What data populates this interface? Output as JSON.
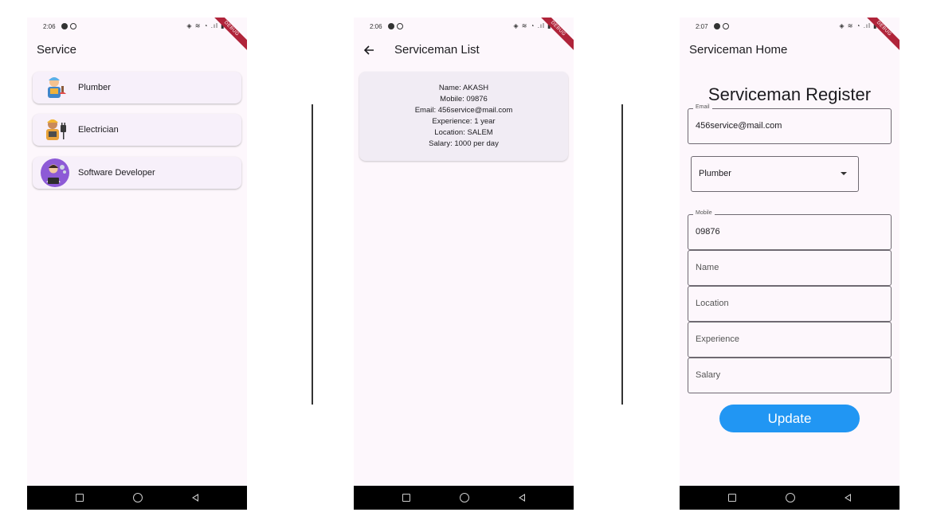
{
  "phone1": {
    "status_time": "2:06",
    "title": "Service",
    "debug_label": "DEBUG",
    "services": [
      {
        "label": "Plumber",
        "icon": "plumber-icon"
      },
      {
        "label": "Electrician",
        "icon": "electrician-icon"
      },
      {
        "label": "Software Developer",
        "icon": "developer-icon"
      }
    ]
  },
  "phone2": {
    "status_time": "2:06",
    "title": "Serviceman List",
    "debug_label": "DEBUG",
    "back_icon": "arrow-back-icon",
    "serviceman": {
      "name": "Name: AKASH",
      "mobile": "Mobile: 09876",
      "email": "Email: 456service@mail.com",
      "experience": "Experience: 1 year",
      "location": "Location: SALEM",
      "salary": "Salary: 1000 per day"
    }
  },
  "phone3": {
    "status_time": "2:07",
    "title": "Serviceman Home",
    "debug_label": "DEBUG",
    "heading": "Serviceman Register",
    "email_label": "Email",
    "email_value": "456service@mail.com",
    "service_selected": "Plumber",
    "mobile_label": "Mobile",
    "mobile_value": "09876",
    "name_hint": "Name",
    "location_hint": "Location",
    "experience_hint": "Experience",
    "salary_hint": "Salary",
    "update_label": "Update"
  },
  "colors": {
    "background": "#fdf7fc",
    "card": "#f7f0fa",
    "primary_button": "#2196f3",
    "debug_ribbon": "#b0243a",
    "navbar": "#000000"
  }
}
